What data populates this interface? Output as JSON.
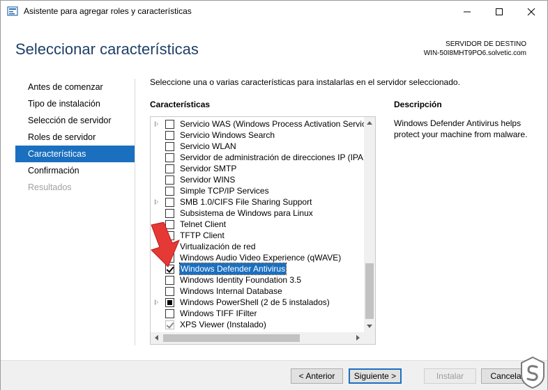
{
  "window": {
    "title": "Asistente para agregar roles y características"
  },
  "header": {
    "page_title": "Seleccionar características",
    "server_label": "SERVIDOR DE DESTINO",
    "server_name": "WIN-50I8MHT9PO6.solvetic.com"
  },
  "nav": {
    "items": [
      {
        "label": "Antes de comenzar",
        "state": "normal"
      },
      {
        "label": "Tipo de instalación",
        "state": "normal"
      },
      {
        "label": "Selección de servidor",
        "state": "normal"
      },
      {
        "label": "Roles de servidor",
        "state": "normal"
      },
      {
        "label": "Características",
        "state": "active"
      },
      {
        "label": "Confirmación",
        "state": "normal"
      },
      {
        "label": "Resultados",
        "state": "disabled"
      }
    ]
  },
  "content": {
    "instruction": "Seleccione una o varias características para instalarlas en el servidor seleccionado.",
    "features_heading": "Características",
    "description_heading": "Descripción",
    "description_text": "Windows Defender Antivirus helps protect your machine from malware."
  },
  "features": [
    {
      "label": "Servicio WAS (Windows Process Activation Service",
      "state": "unchecked",
      "expandable": true
    },
    {
      "label": "Servicio Windows Search",
      "state": "unchecked",
      "expandable": false
    },
    {
      "label": "Servicio WLAN",
      "state": "unchecked",
      "expandable": false
    },
    {
      "label": "Servidor de administración de direcciones IP (IPAM",
      "state": "unchecked",
      "expandable": false
    },
    {
      "label": "Servidor SMTP",
      "state": "unchecked",
      "expandable": false
    },
    {
      "label": "Servidor WINS",
      "state": "unchecked",
      "expandable": false
    },
    {
      "label": "Simple TCP/IP Services",
      "state": "unchecked",
      "expandable": false
    },
    {
      "label": "SMB 1.0/CIFS File Sharing Support",
      "state": "unchecked",
      "expandable": true
    },
    {
      "label": "Subsistema de Windows para Linux",
      "state": "unchecked",
      "expandable": false
    },
    {
      "label": "Telnet Client",
      "state": "unchecked",
      "expandable": false
    },
    {
      "label": "TFTP Client",
      "state": "unchecked",
      "expandable": false
    },
    {
      "label": "Virtualización de red",
      "state": "unchecked",
      "expandable": false
    },
    {
      "label": "Windows Audio Video Experience (qWAVE)",
      "state": "unchecked",
      "expandable": false
    },
    {
      "label": "Windows Defender Antivirus",
      "state": "checked",
      "expandable": false,
      "selected": true
    },
    {
      "label": "Windows Identity Foundation 3.5",
      "state": "unchecked",
      "expandable": false
    },
    {
      "label": "Windows Internal Database",
      "state": "unchecked",
      "expandable": false
    },
    {
      "label": "Windows PowerShell (2 de 5 instalados)",
      "state": "partial",
      "expandable": true
    },
    {
      "label": "Windows TIFF IFilter",
      "state": "unchecked",
      "expandable": false
    },
    {
      "label": "XPS Viewer (Instalado)",
      "state": "greyed-checked",
      "expandable": false
    }
  ],
  "footer": {
    "prev_label": "< Anterior",
    "next_label": "Siguiente >",
    "install_label": "Instalar",
    "cancel_label": "Cancelar"
  },
  "icons": {
    "app": "server-manager-icon",
    "annotation": "red-arrow-icon",
    "watermark": "solvetic-logo"
  },
  "colors": {
    "accent": "#1a6fbf",
    "title": "#1e3f66",
    "annotation": "#e53935"
  }
}
